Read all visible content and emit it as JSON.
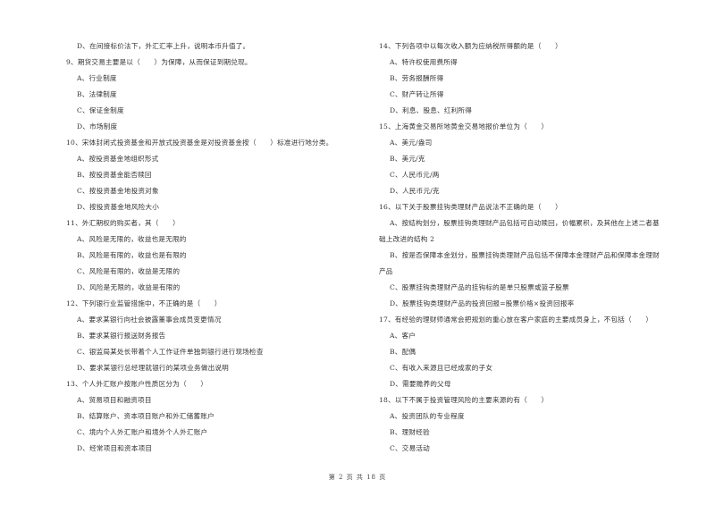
{
  "left_column": [
    {
      "type": "opt",
      "text": "D、在间接标价法下，外汇汇率上升，说明本币升值了。"
    },
    {
      "type": "q",
      "text": "9、期货交易主要是以（　　）为保障，从而保证到期兑现。"
    },
    {
      "type": "opt",
      "text": "A、行业制度"
    },
    {
      "type": "opt",
      "text": "B、法律制度"
    },
    {
      "type": "opt",
      "text": "C、保证金制度"
    },
    {
      "type": "opt",
      "text": "D、市场制度"
    },
    {
      "type": "q",
      "text": "10、宋体封闭式投资基金和开放式投资基金是对投资基金按（　　）标准进行地分类。"
    },
    {
      "type": "opt",
      "text": "A、按投资基金地组织形式"
    },
    {
      "type": "opt",
      "text": "B、按投资基金能否赎回"
    },
    {
      "type": "opt",
      "text": "C、按投资基金地投资对象"
    },
    {
      "type": "opt",
      "text": "D、按投资基金地风险大小"
    },
    {
      "type": "q",
      "text": "11、外汇期权的购买者，其（　　）"
    },
    {
      "type": "opt",
      "text": "A、风险是无限的，收益也是无限的"
    },
    {
      "type": "opt",
      "text": "B、风险是有限的，收益也是有限的"
    },
    {
      "type": "opt",
      "text": "C、风险是有限的，收益是无限的"
    },
    {
      "type": "opt",
      "text": "D、风险是无限的，收益是有限的"
    },
    {
      "type": "q",
      "text": "12、下列银行业监管措施中，不正确的是（　　）"
    },
    {
      "type": "opt",
      "text": "A、要求某银行向社会披露董事会成员变更情况"
    },
    {
      "type": "opt",
      "text": "B、要求某银行报送财务报告"
    },
    {
      "type": "opt",
      "text": "C、银监局某处长带着个人工作证件单独到银行进行现场检查"
    },
    {
      "type": "opt",
      "text": "D、要求某银行总经理就银行的某项业务做出说明"
    },
    {
      "type": "q",
      "text": "13、个人外汇账户按账户性质区分为（　　）"
    },
    {
      "type": "opt",
      "text": "A、贸易项目和融资项目"
    },
    {
      "type": "opt",
      "text": "B、结算账户、资本项目账户和外汇储蓄账户"
    },
    {
      "type": "opt",
      "text": "C、境内个人外汇账户和境外个人外汇账户"
    },
    {
      "type": "opt",
      "text": "D、经常项目和资本项目"
    }
  ],
  "right_column": [
    {
      "type": "q",
      "text": "14、下列各项中以每次收入额为应纳税所得额的是（　　）"
    },
    {
      "type": "opt",
      "text": "A、特许权使用费所得"
    },
    {
      "type": "opt",
      "text": "B、劳务报酬所得"
    },
    {
      "type": "opt",
      "text": "C、财产转让所得"
    },
    {
      "type": "opt",
      "text": "D、利息、股息、红利所得"
    },
    {
      "type": "q",
      "text": "15、上海黄金交易所地黄金交易地报价单位为（　　）"
    },
    {
      "type": "opt",
      "text": "A、美元/盎司"
    },
    {
      "type": "opt",
      "text": "B、美元/克"
    },
    {
      "type": "opt",
      "text": "C、人民币元/两"
    },
    {
      "type": "opt",
      "text": "D、人民币元/克"
    },
    {
      "type": "q",
      "text": "16、以下关于股票挂钩类理财产品说法不正确的是（　　）"
    },
    {
      "type": "opt",
      "text": "A、按结构划分，股票挂钩类理财产品包括可自动赎回，价幅累积，及其他在上述二者基"
    },
    {
      "type": "cont",
      "text": "础上改进的结构 2"
    },
    {
      "type": "opt",
      "text": "B、按是否保障本金划分，股票挂钩类理财产品包括不保障本金理财产品和保障本金理财"
    },
    {
      "type": "cont",
      "text": "产品"
    },
    {
      "type": "opt",
      "text": "C、股票挂钩类理财产品的挂钩标的是单只股票或篮子股票"
    },
    {
      "type": "opt",
      "text": "D、股票挂钩类理财产品的投资回报=股票价格×投资回报率"
    },
    {
      "type": "q",
      "text": "17、有经验的理财师通常会把规划的重心放在客户家庭的主要成员身上，不包括（　　）"
    },
    {
      "type": "opt",
      "text": "A、客户"
    },
    {
      "type": "opt",
      "text": "B、配偶"
    },
    {
      "type": "opt",
      "text": "C、有收入来源且已经成家的子女"
    },
    {
      "type": "opt",
      "text": "D、需要赡养的父母"
    },
    {
      "type": "q",
      "text": "18、以下不属于投资管理风险的主要来源的有（　　）"
    },
    {
      "type": "opt",
      "text": "A、投资团队的专业程度"
    },
    {
      "type": "opt",
      "text": "B、理财经验"
    },
    {
      "type": "opt",
      "text": "C、交易活动"
    }
  ],
  "footer": {
    "page_label": "第 2 页 共 18 页"
  }
}
